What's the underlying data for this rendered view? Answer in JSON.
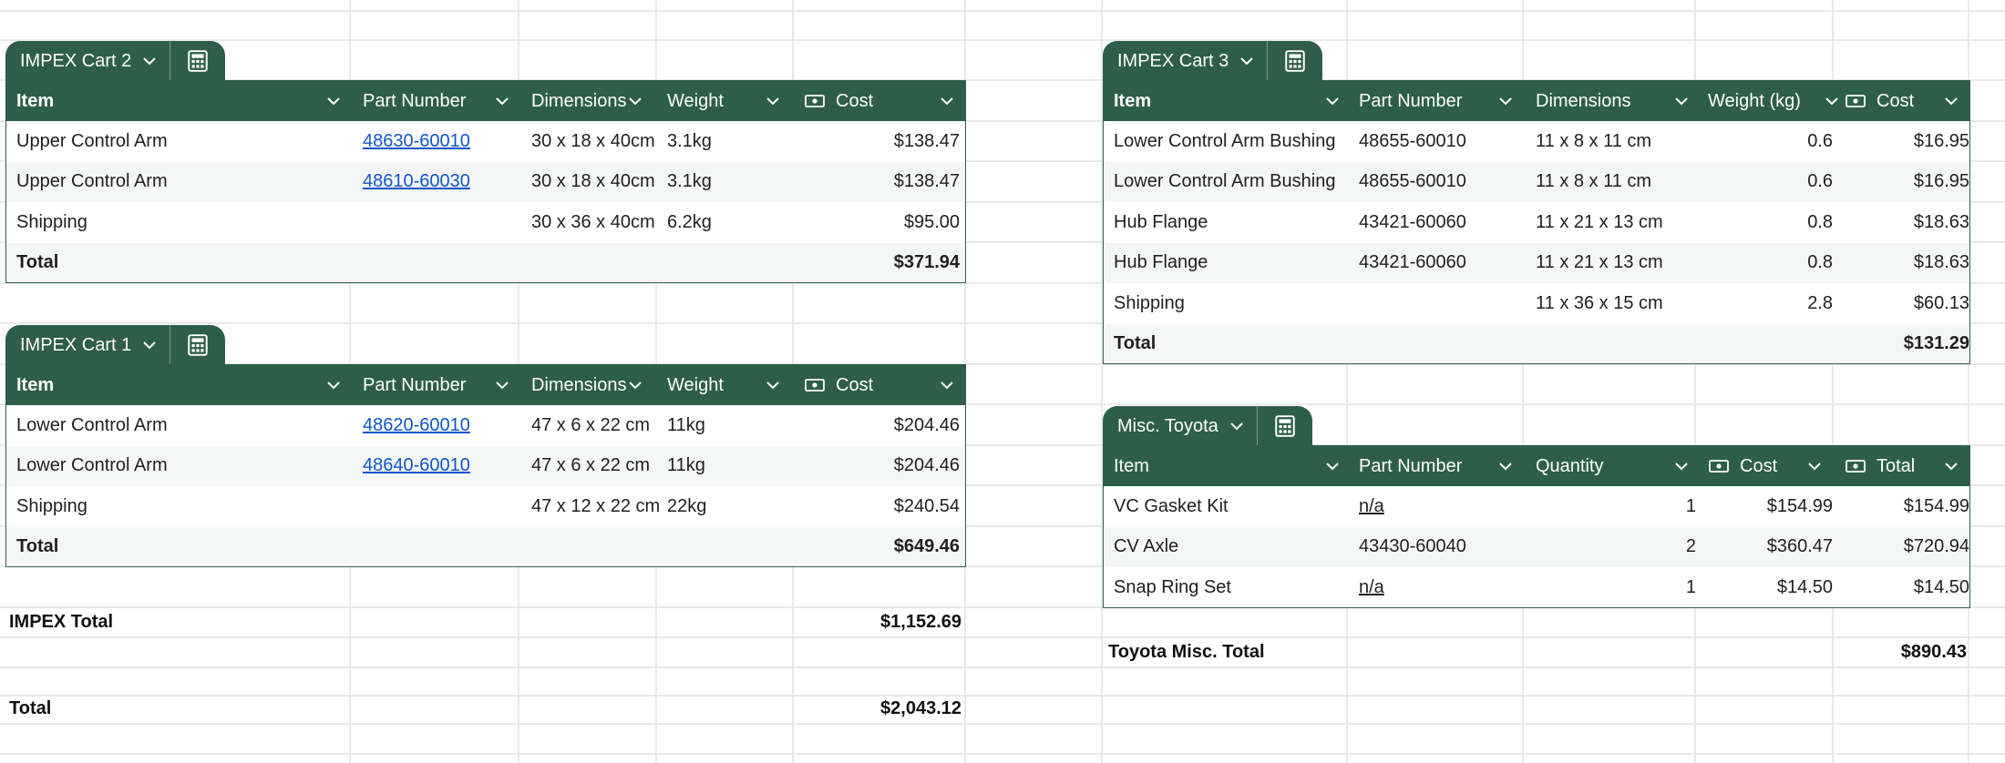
{
  "colors": {
    "header_bg": "#2e5e4a",
    "link": "#1155cc",
    "grid_line": "#e2e2e2"
  },
  "cart2": {
    "name": "IMPEX Cart 2",
    "headers": [
      "Item",
      "Part Number",
      "Dimensions",
      "Weight",
      "Cost"
    ],
    "rows": [
      {
        "item": "Upper Control Arm",
        "part": "48630-60010",
        "dim": "30 x 18 x 40cm",
        "weight": "3.1kg",
        "cost": "$138.47"
      },
      {
        "item": "Upper Control Arm",
        "part": "48610-60030",
        "dim": "30 x 18 x 40cm",
        "weight": "3.1kg",
        "cost": "$138.47"
      },
      {
        "item": "Shipping",
        "part": "",
        "dim": "30 x 36 x 40cm",
        "weight": "6.2kg",
        "cost": "$95.00"
      }
    ],
    "total_label": "Total",
    "total_value": "$371.94"
  },
  "cart1": {
    "name": "IMPEX Cart 1",
    "headers": [
      "Item",
      "Part Number",
      "Dimensions",
      "Weight",
      "Cost"
    ],
    "rows": [
      {
        "item": "Lower Control Arm",
        "part": "48620-60010",
        "dim": "47 x 6 x 22 cm",
        "weight": "11kg",
        "cost": "$204.46"
      },
      {
        "item": "Lower Control Arm",
        "part": "48640-60010",
        "dim": "47 x 6 x 22 cm",
        "weight": "11kg",
        "cost": "$204.46"
      },
      {
        "item": "Shipping",
        "part": "",
        "dim": "47 x 12 x 22 cm",
        "weight": "22kg",
        "cost": "$240.54"
      }
    ],
    "total_label": "Total",
    "total_value": "$649.46"
  },
  "cart3": {
    "name": "IMPEX Cart 3",
    "headers": [
      "Item",
      "Part Number",
      "Dimensions",
      "Weight (kg)",
      "Cost"
    ],
    "rows": [
      {
        "item": "Lower Control Arm Bushing",
        "part": "48655-60010",
        "dim": "11 x 8 x 11 cm",
        "weight": "0.6",
        "cost": "$16.95"
      },
      {
        "item": "Lower Control Arm Bushing",
        "part": "48655-60010",
        "dim": "11 x 8 x 11 cm",
        "weight": "0.6",
        "cost": "$16.95"
      },
      {
        "item": "Hub Flange",
        "part": "43421-60060",
        "dim": "11 x 21 x 13 cm",
        "weight": "0.8",
        "cost": "$18.63"
      },
      {
        "item": "Hub Flange",
        "part": "43421-60060",
        "dim": "11 x 21 x 13 cm",
        "weight": "0.8",
        "cost": "$18.63"
      },
      {
        "item": "Shipping",
        "part": "",
        "dim": "11 x 36 x 15 cm",
        "weight": "2.8",
        "cost": "$60.13"
      }
    ],
    "total_label": "Total",
    "total_value": "$131.29"
  },
  "misc": {
    "name": "Misc. Toyota",
    "headers": [
      "Item",
      "Part Number",
      "Quantity",
      "Cost",
      "Total"
    ],
    "rows": [
      {
        "item": "VC Gasket Kit",
        "part": "n/a",
        "qty": "1",
        "cost": "$154.99",
        "total": "$154.99"
      },
      {
        "item": "CV Axle",
        "part": "43430-60040",
        "qty": "2",
        "cost": "$360.47",
        "total": "$720.94"
      },
      {
        "item": "Snap Ring Set",
        "part": "n/a",
        "qty": "1",
        "cost": "$14.50",
        "total": "$14.50"
      }
    ]
  },
  "summary": {
    "impex_total_label": "IMPEX Total",
    "impex_total_value": "$1,152.69",
    "grand_total_label": "Total",
    "grand_total_value": "$2,043.12",
    "toyota_total_label": "Toyota Misc. Total",
    "toyota_total_value": "$890.43"
  }
}
